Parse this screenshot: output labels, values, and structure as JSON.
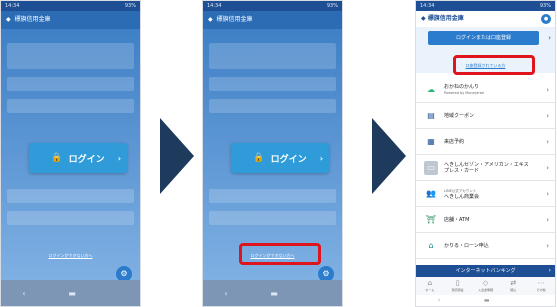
{
  "status_bar": {
    "time": "14:34",
    "battery": "93%"
  },
  "app_title": "標旗信用金庫",
  "login_button": {
    "label": "ログイン"
  },
  "help_link": "ログインができない方へ",
  "arrows": [
    "next",
    "next"
  ],
  "phone3": {
    "app_title": "標旗信用金庫",
    "login_top_button": "ログインまたは口座登録",
    "password_link": "口座登録されている方",
    "menu": [
      {
        "label": "おかねのかんり",
        "sub": "Powered by Moneytree",
        "icon": "wallet-icon"
      },
      {
        "label": "地域クーポン",
        "sub": "",
        "icon": "coupon-icon"
      },
      {
        "label": "来店予約",
        "sub": "",
        "icon": "calendar-icon"
      },
      {
        "label": "へきしんセゾン・アメリカン・エキスプレス・カード",
        "sub": "",
        "icon": "card-icon"
      },
      {
        "label": "へきしん商業会",
        "sub": "LINE公式アカウント",
        "icon": "people-icon"
      },
      {
        "label": "店舗・ATM",
        "sub": "",
        "icon": "atm-icon"
      },
      {
        "label": "かりる・ローン申込",
        "sub": "",
        "icon": "home-icon"
      }
    ],
    "ib_bar": "インターネットバンキング",
    "tabs": [
      "ホーム",
      "残高照会",
      "入出金明細",
      "振込",
      "その他"
    ]
  },
  "colors": {
    "brand": "#1e4f95",
    "highlight": "#e0141c",
    "arrow": "#1e3a5c"
  }
}
